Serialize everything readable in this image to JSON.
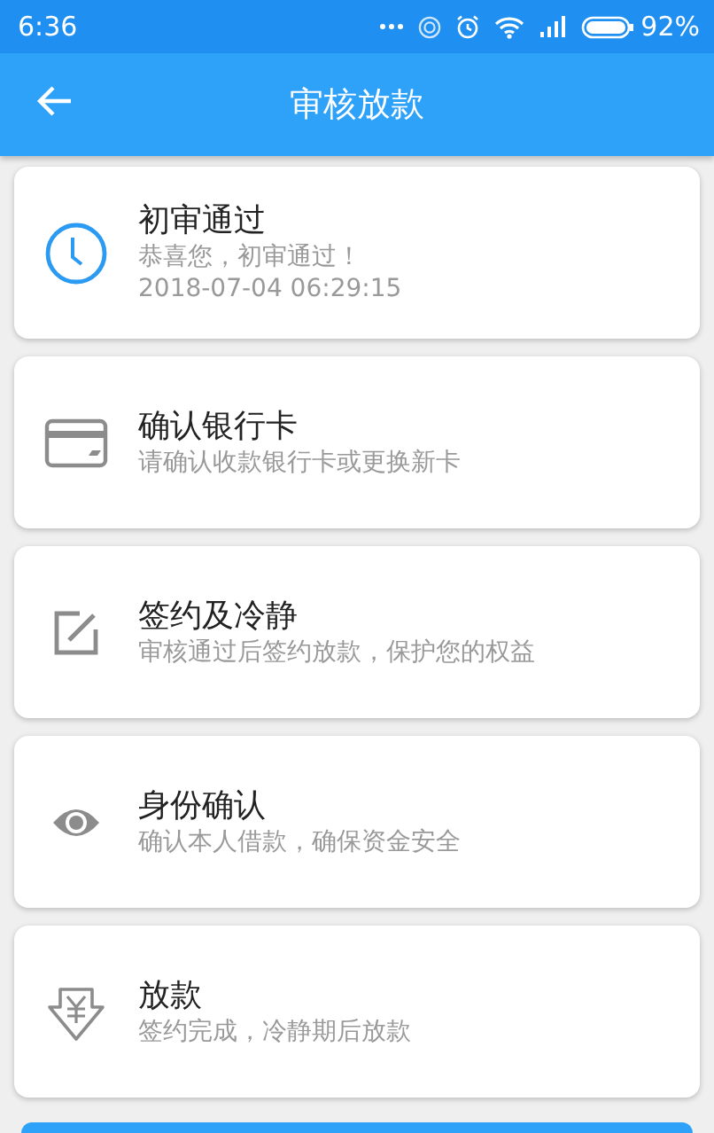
{
  "status_bar": {
    "time": "6:36",
    "battery_text": "92%"
  },
  "app_bar": {
    "title": "审核放款"
  },
  "steps": [
    {
      "kind": "clock",
      "completed": true,
      "title": "初审通过",
      "lines": [
        "恭喜您，初审通过！",
        "2018-07-04 06:29:15"
      ]
    },
    {
      "kind": "card",
      "completed": false,
      "title": "确认银行卡",
      "lines": [
        "请确认收款银行卡或更换新卡"
      ]
    },
    {
      "kind": "edit",
      "completed": false,
      "title": "签约及冷静",
      "lines": [
        "审核通过后签约放款，保护您的权益"
      ]
    },
    {
      "kind": "eye",
      "completed": false,
      "title": "身份确认",
      "lines": [
        "确认本人借款，确保资金安全"
      ]
    },
    {
      "kind": "yen",
      "completed": false,
      "title": "放款",
      "lines": [
        "签约完成，冷静期后放款"
      ]
    }
  ]
}
